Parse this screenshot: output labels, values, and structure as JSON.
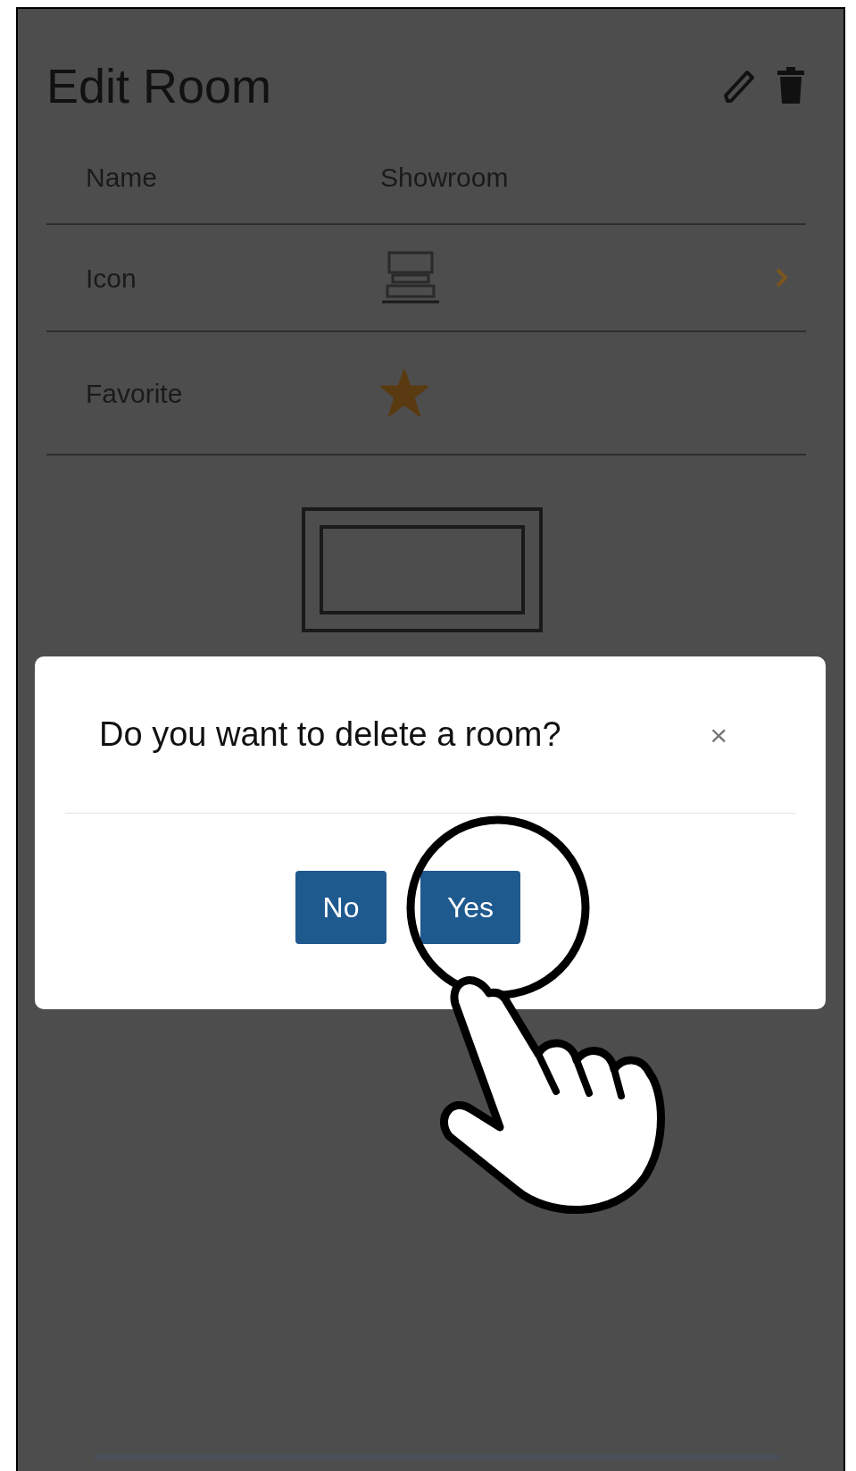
{
  "header": {
    "title": "Edit Room"
  },
  "rows": [
    {
      "kind": "text",
      "label": "Name",
      "value": "Showroom"
    },
    {
      "kind": "icon",
      "label": "Icon"
    },
    {
      "kind": "star",
      "label": "Favorite",
      "favorite": true
    }
  ],
  "dialog": {
    "title": "Do you want to delete a room?",
    "close": "×",
    "buttons": [
      "No",
      "Yes"
    ]
  }
}
